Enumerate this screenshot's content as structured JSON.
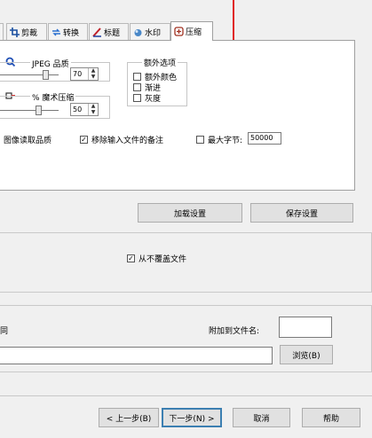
{
  "tabs": [
    {
      "label": "剪裁",
      "icon": "crop-icon"
    },
    {
      "label": "转换",
      "icon": "convert-icon"
    },
    {
      "label": "标题",
      "icon": "title-icon"
    },
    {
      "label": "水印",
      "icon": "watermark-icon"
    },
    {
      "label": "压缩",
      "icon": "compress-icon",
      "active": true
    }
  ],
  "compress": {
    "jpeg_quality_label": "JPEG 品质",
    "jpeg_quality_value": "70",
    "magic_compress_label": "% 魔术压缩",
    "magic_compress_value": "50",
    "extra_options_legend": "额外选项",
    "extra_options": [
      {
        "label": "额外颜色",
        "checked": false
      },
      {
        "label": "渐进",
        "checked": false
      },
      {
        "label": "灰度",
        "checked": false
      }
    ],
    "read_quality_label": "图像读取品质",
    "remove_comments_label": "移除输入文件的备注",
    "remove_comments_checked": true,
    "max_bytes_label": "最大字节:",
    "max_bytes_checked": false,
    "max_bytes_value": "50000"
  },
  "buttons": {
    "load_settings": "加载设置",
    "save_settings": "保存设置",
    "browse": "浏览(B)",
    "prev": "< 上一步(B)",
    "next": "下一步(N) >",
    "cancel": "取消",
    "help": "帮助"
  },
  "output": {
    "no_overwrite_label": "从不覆盖文件",
    "no_overwrite_checked": true,
    "same_label": "同",
    "append_label": "附加到文件名:",
    "append_value": "",
    "path_value": ""
  },
  "colors": {
    "annotation_red": "#e0201e",
    "default_button_border": "#3c7fb1"
  }
}
